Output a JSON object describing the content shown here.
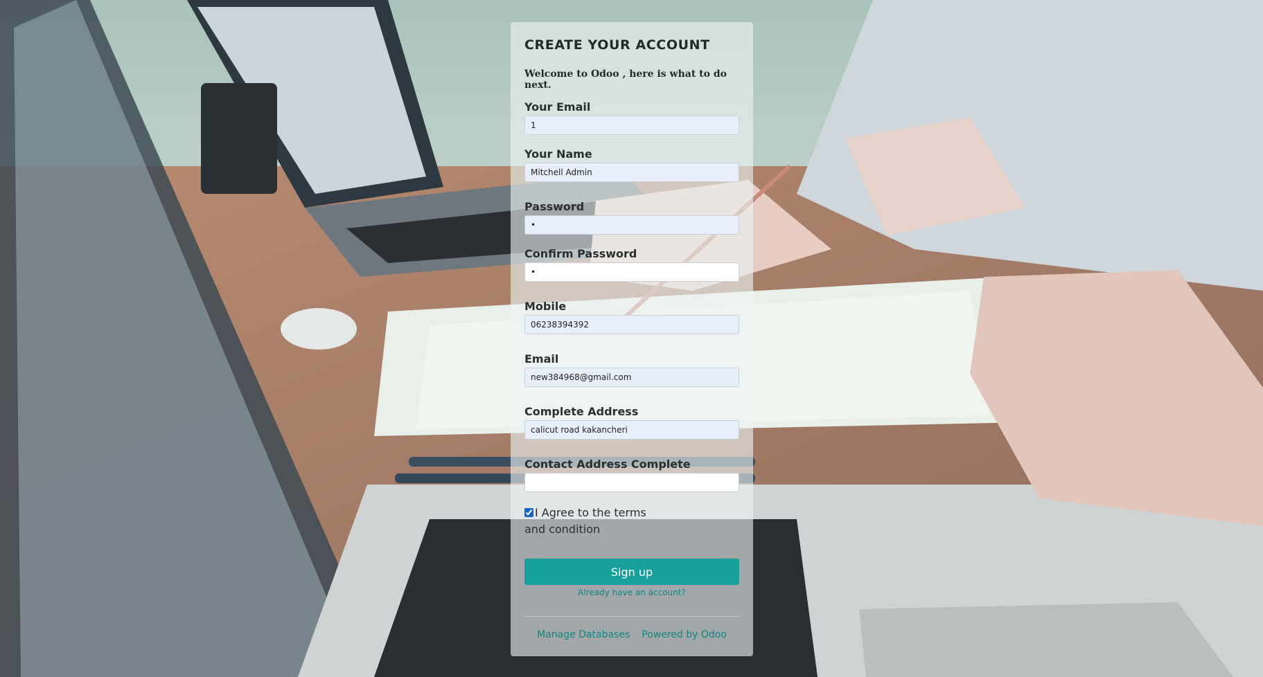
{
  "form": {
    "title": "CREATE YOUR ACCOUNT",
    "welcome": "Welcome to Odoo , here is what to do next.",
    "fields": [
      {
        "label": "Your Email",
        "value": "1"
      },
      {
        "label": "Your Name",
        "value": "Mitchell Admin"
      },
      {
        "label": "Password",
        "value": "•"
      },
      {
        "label": "Confirm Password",
        "value": "•"
      },
      {
        "label": "Mobile",
        "value": "06238394392"
      },
      {
        "label": "Email",
        "value": "new384968@gmail.com"
      },
      {
        "label": "Complete Address",
        "value": "calicut road kakancheri"
      },
      {
        "label": "Contact Address Complete",
        "value": ""
      }
    ],
    "agree_checked": true,
    "agree_text": "I Agree to the terms and condition",
    "signup_label": "Sign up",
    "already_label": "Already have an account?"
  },
  "footer": {
    "manage_databases": "Manage Databases",
    "powered_by": "Powered by Odoo"
  },
  "colors": {
    "primary": "#17a09c",
    "link": "#0f8585",
    "input_bg": "#e8effa"
  }
}
